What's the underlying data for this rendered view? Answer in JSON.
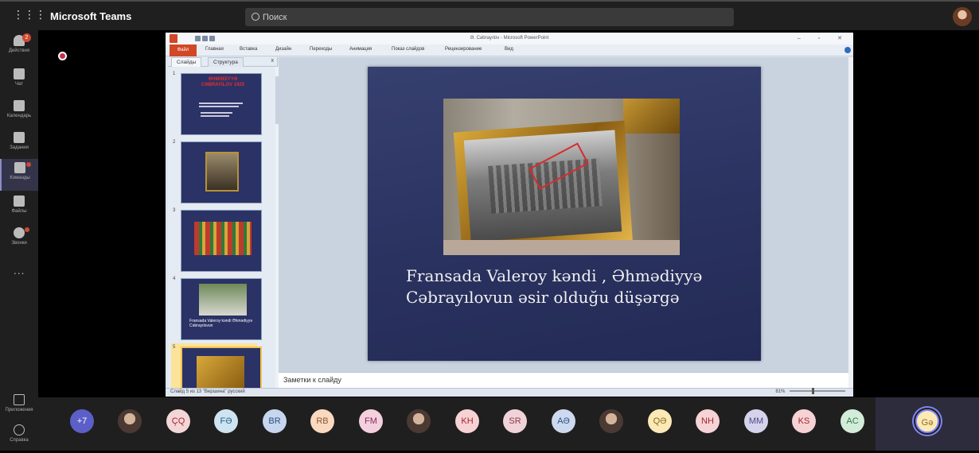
{
  "topbar": {
    "app_title": "Microsoft Teams",
    "search_placeholder": "Поиск"
  },
  "rail": {
    "items": [
      {
        "label": "Действия",
        "badge": "2"
      },
      {
        "label": "Чат"
      },
      {
        "label": "Календарь"
      },
      {
        "label": "Задания"
      },
      {
        "label": "Команды",
        "active": true
      },
      {
        "label": "Файлы"
      },
      {
        "label": "Звонки"
      }
    ],
    "more_label": "...",
    "apps_label": "Приложения",
    "help_label": "Справка"
  },
  "ppt": {
    "window_title": "Ə. Cəbrayılov - Microsoft PowerPoint",
    "ribbon_tabs": [
      "Файл",
      "Главная",
      "Вставка",
      "Дизайн",
      "Переходы",
      "Анимация",
      "Показ слайдов",
      "Рецензирование",
      "Вид"
    ],
    "pane_tabs": [
      "Слайды",
      "Структура"
    ],
    "pane_close": "x",
    "thumb_numbers": [
      "1",
      "2",
      "3",
      "4",
      "5"
    ],
    "thumb1_title": "ƏHMƏDİYYƏ CƏBRAYILOV 1925",
    "thumb4_caption": "Fransada Valeroy kəndi Əhmədiyyə Cəbrayılovun",
    "slide_caption": "Fransada Valeroy kəndi , Əhmədiyyə Cəbrayılovun əsir olduğu düşərgə",
    "notes_placeholder": "Заметки к слайду",
    "status_left": "Слайд 5 из 13   \"Вершина\"   русский",
    "zoom_level": "81%"
  },
  "participants": [
    {
      "initials": "+7",
      "bg": "#5b5fc7",
      "fg": "#ffffff"
    },
    {
      "initials": "",
      "photo": true
    },
    {
      "initials": "ÇQ",
      "bg": "#f3d6d8",
      "fg": "#a4262c"
    },
    {
      "initials": "FƏ",
      "bg": "#cfe4f0",
      "fg": "#1f5f8b"
    },
    {
      "initials": "BR",
      "bg": "#c5d6ee",
      "fg": "#2b4f81"
    },
    {
      "initials": "RB",
      "bg": "#f9d9c0",
      "fg": "#8e562e"
    },
    {
      "initials": "FM",
      "bg": "#f3d0de",
      "fg": "#8a2b5a"
    },
    {
      "initials": "",
      "photo": true
    },
    {
      "initials": "KH",
      "bg": "#f7d2d5",
      "fg": "#a4262c"
    },
    {
      "initials": "SR",
      "bg": "#f0d3d9",
      "fg": "#8a3a4a"
    },
    {
      "initials": "AƏ",
      "bg": "#cdd9ef",
      "fg": "#2b4f81"
    },
    {
      "initials": "",
      "photo": true
    },
    {
      "initials": "QƏ",
      "bg": "#fbe9b6",
      "fg": "#8a6a1a"
    },
    {
      "initials": "NH",
      "bg": "#f5d3d6",
      "fg": "#a4262c"
    },
    {
      "initials": "MM",
      "bg": "#d5d3ec",
      "fg": "#4b4a8a"
    },
    {
      "initials": "KS",
      "bg": "#f6d2d5",
      "fg": "#a4262c"
    },
    {
      "initials": "AC",
      "bg": "#d3ecd9",
      "fg": "#2f7a45"
    },
    {
      "initials": "Gə",
      "bg": "#fbe9b6",
      "fg": "#8a6a1a",
      "self": true
    }
  ]
}
